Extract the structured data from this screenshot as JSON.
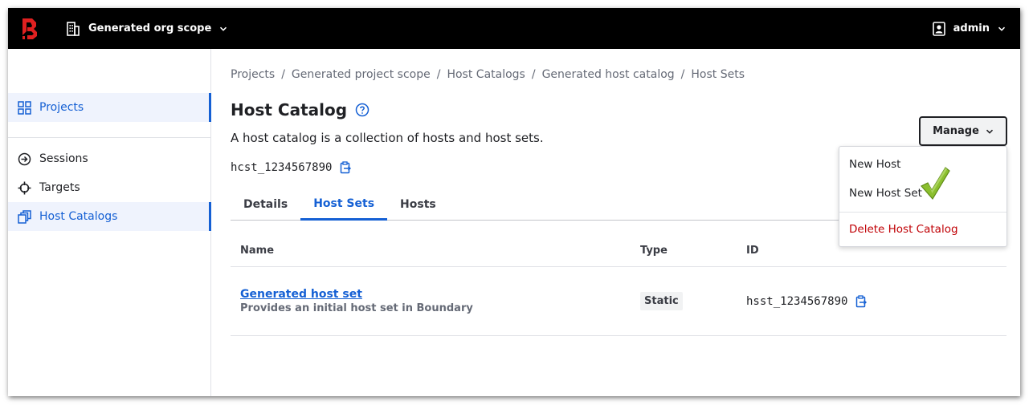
{
  "header": {
    "scope_label": "Generated org scope",
    "user_label": "admin"
  },
  "sidebar": {
    "items": [
      {
        "label": "Projects",
        "active": true
      },
      {
        "label": "Sessions",
        "active": false
      },
      {
        "label": "Targets",
        "active": false
      },
      {
        "label": "Host Catalogs",
        "active": true
      }
    ]
  },
  "breadcrumbs": [
    "Projects",
    "Generated project scope",
    "Host Catalogs",
    "Generated host catalog",
    "Host Sets"
  ],
  "page": {
    "title": "Host Catalog",
    "description": "A host catalog is a collection of hosts and host sets.",
    "id": "hcst_1234567890"
  },
  "tabs": [
    {
      "label": "Details",
      "active": false
    },
    {
      "label": "Host Sets",
      "active": true
    },
    {
      "label": "Hosts",
      "active": false
    }
  ],
  "table": {
    "columns": [
      "Name",
      "Type",
      "ID"
    ],
    "rows": [
      {
        "name": "Generated host set",
        "description": "Provides an initial host set in Boundary",
        "type": "Static",
        "id": "hsst_1234567890"
      }
    ]
  },
  "manage": {
    "label": "Manage",
    "items": [
      "New Host",
      "New Host Set",
      "Delete Host Catalog"
    ]
  },
  "colors": {
    "accent": "#1560d4",
    "danger": "#c00005",
    "header_bg": "#000000",
    "brand": "#e02020"
  }
}
